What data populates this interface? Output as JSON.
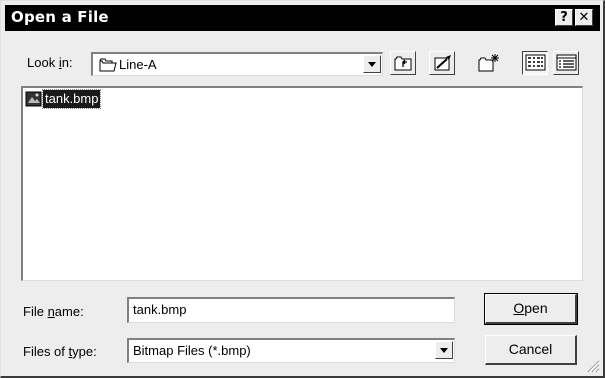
{
  "window": {
    "title": "Open a File",
    "help_label": "?",
    "close_label": "✕"
  },
  "look_in": {
    "label_prefix": "Look ",
    "label_accel": "i",
    "label_suffix": "n:",
    "value": "Line-A",
    "icon": "folder-icon"
  },
  "toolbar": {
    "up_icon": "up-one-level-icon",
    "desktop_icon": "desktop-icon",
    "new_folder_icon": "new-folder-icon",
    "list_icon": "list-view-icon",
    "details_icon": "details-view-icon"
  },
  "files": [
    {
      "name": "tank.bmp",
      "icon": "bitmap-file-icon",
      "selected": true
    }
  ],
  "file_name": {
    "label_prefix": "File ",
    "label_accel": "n",
    "label_suffix": "ame:",
    "value": "tank.bmp"
  },
  "file_type": {
    "label_prefix": "Files of ",
    "label_accel": "t",
    "label_suffix": "ype:",
    "value": "Bitmap Files (*.bmp)"
  },
  "buttons": {
    "open_accel": "O",
    "open_rest": "pen",
    "cancel_label": "Cancel"
  }
}
